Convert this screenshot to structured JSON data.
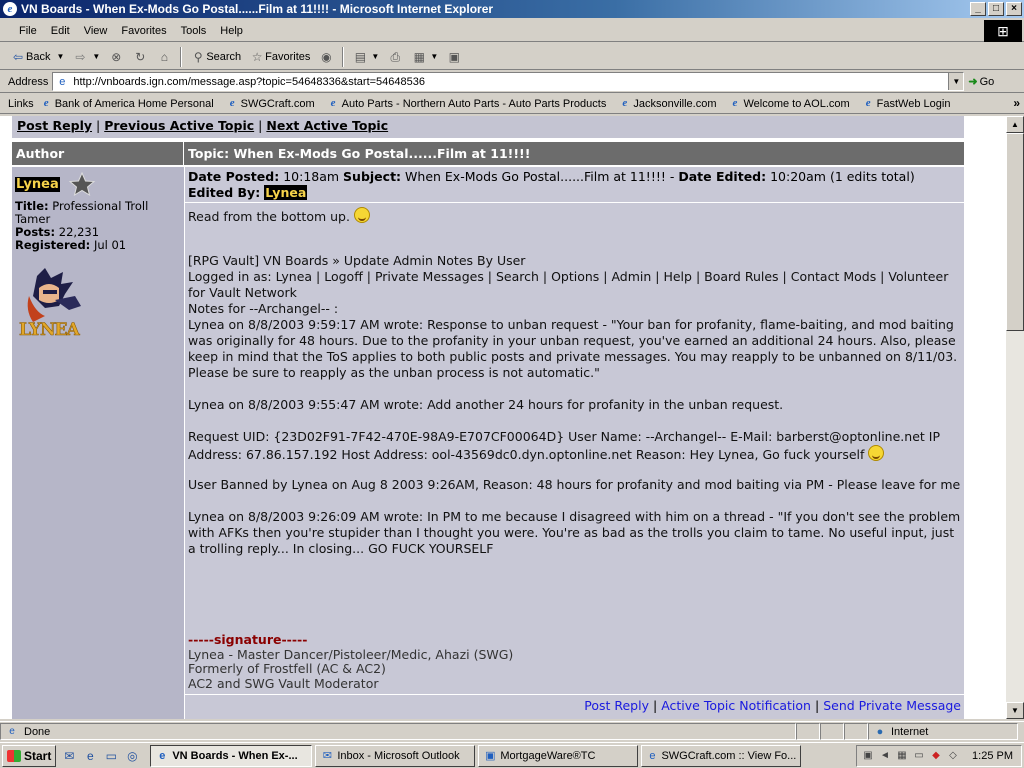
{
  "window": {
    "title": "VN Boards - When Ex-Mods Go Postal......Film at 11!!!! - Microsoft Internet Explorer"
  },
  "menu": [
    "File",
    "Edit",
    "View",
    "Favorites",
    "Tools",
    "Help"
  ],
  "toolbar": {
    "back": "Back",
    "search": "Search",
    "favorites": "Favorites"
  },
  "address": {
    "label": "Address",
    "url": "http://vnboards.ign.com/message.asp?topic=54648336&start=54648536",
    "go": "Go"
  },
  "links": {
    "label": "Links",
    "items": [
      "Bank of America  Home  Personal",
      "SWGCraft.com",
      "Auto Parts - Northern Auto Parts - Auto Parts Products",
      "Jacksonville.com",
      "Welcome to AOL.com",
      "FastWeb Login"
    ]
  },
  "nav": {
    "post_reply": "Post Reply",
    "prev_topic": "Previous Active Topic",
    "next_topic": "Next Active Topic",
    "sep": "|"
  },
  "header": {
    "author": "Author",
    "topic": "Topic: When Ex-Mods Go Postal......Film at 11!!!!"
  },
  "author": {
    "name": "Lynea",
    "title_label": "Title:",
    "title_value": "Professional Troll Tamer",
    "posts_label": "Posts:",
    "posts_value": "22,231",
    "registered_label": "Registered:",
    "registered_value": "Jul 01",
    "avatar_text": "LYNEA"
  },
  "meta": {
    "date_posted_label": "Date Posted:",
    "date_posted": "10:18am",
    "subject_label": "Subject:",
    "subject": "When Ex-Mods Go Postal......Film at 11!!!!",
    "date_edited_label": "Date Edited:",
    "date_edited": "10:20am (1 edits total)",
    "edited_by_label": "Edited By:",
    "edited_by": "Lynea"
  },
  "post": {
    "intro": "Read from the bottom up.",
    "p1": "[RPG Vault] VN Boards » Update Admin Notes By User\nLogged in as: Lynea | Logoff | Private Messages | Search | Options | Admin | Help | Board Rules | Contact Mods | Volunteer for Vault Network\nNotes for --Archangel-- :\nLynea on 8/8/2003 9:59:17 AM wrote: Response to unban request - \"Your ban for profanity, flame-baiting, and mod baiting was originally for 48 hours. Due to the profanity in your unban request, you've earned an additional 24 hours. Also, please keep in mind that the ToS applies to both public posts and private messages. You may reapply to be unbanned on 8/11/03. Please be sure to reapply as the unban process is not automatic.\"",
    "p2": "Lynea on 8/8/2003 9:55:47 AM wrote: Add another 24 hours for profanity in the unban request.",
    "p3": "Request UID: {23D02F91-7F42-470E-98A9-E707CF00064D} User Name: --Archangel-- E-Mail: barberst@optonline.net IP Address: 67.86.157.192 Host Address: ool-43569dc0.dyn.optonline.net Reason: Hey Lynea, Go fuck yourself",
    "p4": "User Banned by Lynea on Aug 8 2003 9:26AM, Reason: 48 hours for profanity and mod baiting via PM - Please leave for me",
    "p5": "Lynea on 8/8/2003 9:26:09 AM wrote: In PM to me because I disagreed with him on a thread - \"If you don't see the problem with AFKs then you're stupider than I thought you were. You're as bad as the trolls you claim to tame. No useful input, just a trolling reply... In closing... GO FUCK YOURSELF"
  },
  "signature": {
    "head": "-----signature-----",
    "lines": [
      "Lynea - Master Dancer/Pistoleer/Medic, Ahazi (SWG)",
      "Formerly of Frostfell (AC & AC2)",
      "AC2 and SWG Vault Moderator"
    ]
  },
  "actions": {
    "post_reply": "Post Reply",
    "notify": "Active Topic Notification",
    "pm": "Send Private Message"
  },
  "status": {
    "text": "Done",
    "zone": "Internet"
  },
  "taskbar": {
    "start": "Start",
    "tasks": [
      "VN Boards - When Ex-...",
      "Inbox - Microsoft Outlook",
      "MortgageWare®TC",
      "SWGCraft.com :: View Fo..."
    ],
    "clock": "1:25 PM"
  }
}
